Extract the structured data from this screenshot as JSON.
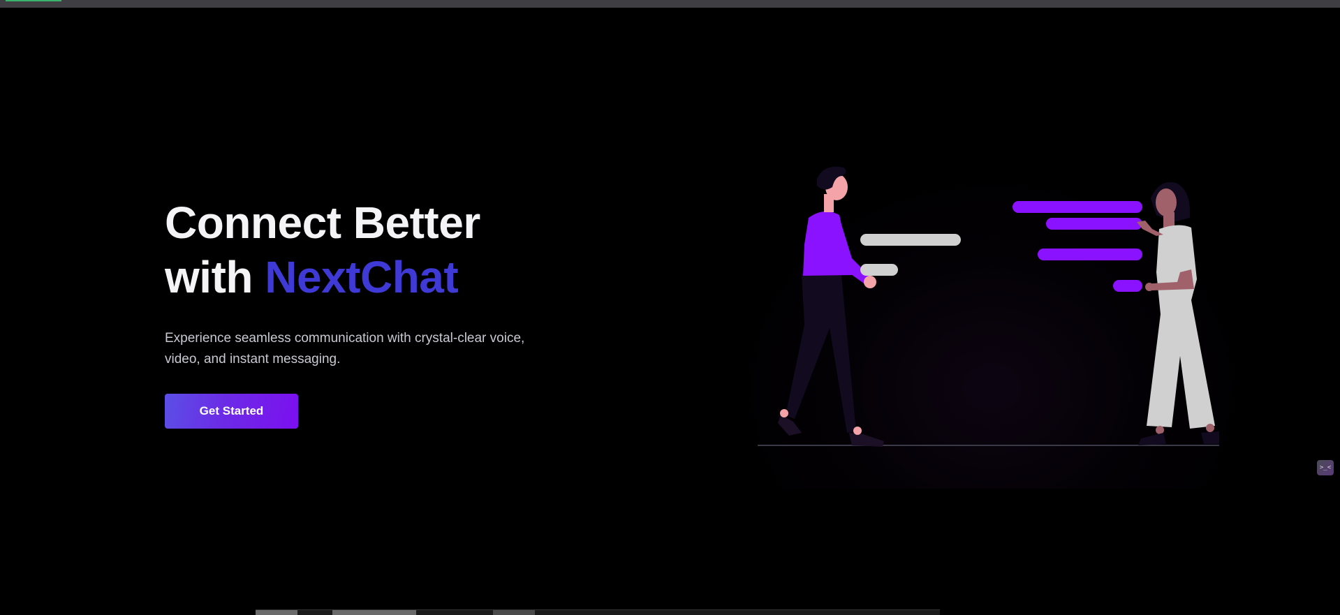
{
  "hero": {
    "headline_line1": "Connect Better",
    "headline_with": "with",
    "headline_brand": "NextChat",
    "subtitle": "Experience seamless communication with crystal-clear voice, video, and instant messaging.",
    "cta_label": "Get Started"
  },
  "widget": {
    "label": ">_<"
  },
  "colors": {
    "background": "#000000",
    "brand_text": "#3f3ad6",
    "cta_gradient_start": "#5b4fe6",
    "cta_gradient_end": "#7c0ff0",
    "illustration_purple": "#8a12ff",
    "illustration_gray": "#d0d0d0",
    "skin_light": "#f4a3a8",
    "skin_dark": "#a0616a"
  },
  "icons": {
    "illustration": "people-chatting-illustration",
    "widget": "terminal-face-icon"
  }
}
